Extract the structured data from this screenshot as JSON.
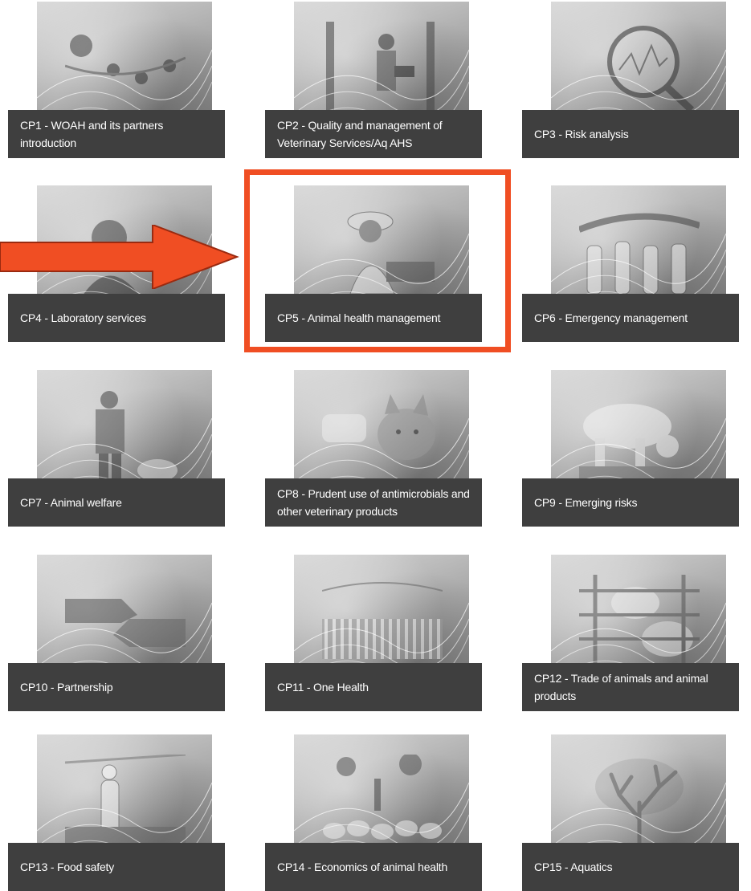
{
  "colors": {
    "caption_bg": "#3f3f3f",
    "caption_text": "#ffffff",
    "highlight": "#f04e23",
    "arrow": "#f04e23"
  },
  "annotation": {
    "highlighted_card": "CP5",
    "arrow_icon": "right-arrow-icon"
  },
  "cards": [
    {
      "id": "cp1",
      "title": "CP1 - WOAH and its partners introduction",
      "icon": "bees-photo-icon"
    },
    {
      "id": "cp2",
      "title": "CP2 - Quality and management of Veterinary Services/Aq AHS",
      "icon": "inspector-photo-icon"
    },
    {
      "id": "cp3",
      "title": "CP3 - Risk analysis",
      "icon": "magnifier-photo-icon"
    },
    {
      "id": "cp4",
      "title": "CP4 - Laboratory services",
      "icon": "scientist-photo-icon"
    },
    {
      "id": "cp5",
      "title": "CP5 - Animal health management",
      "icon": "beekeeper-photo-icon"
    },
    {
      "id": "cp6",
      "title": "CP6 - Emergency management",
      "icon": "hazmat-team-photo-icon"
    },
    {
      "id": "cp7",
      "title": "CP7 - Animal welfare",
      "icon": "farmer-photo-icon"
    },
    {
      "id": "cp8",
      "title": "CP8 - Prudent use of antimicrobials and other veterinary products",
      "icon": "cat-vet-photo-icon"
    },
    {
      "id": "cp9",
      "title": "CP9 - Emerging risks",
      "icon": "polar-bear-photo-icon"
    },
    {
      "id": "cp10",
      "title": "CP10 - Partnership",
      "icon": "handshake-photo-icon"
    },
    {
      "id": "cp11",
      "title": "CP11 - One Health",
      "icon": "underwater-photo-icon"
    },
    {
      "id": "cp12",
      "title": "CP12 - Trade of animals and animal products",
      "icon": "cattle-pen-photo-icon"
    },
    {
      "id": "cp13",
      "title": "CP13 - Food safety",
      "icon": "poultry-house-photo-icon"
    },
    {
      "id": "cp14",
      "title": "CP14 - Economics of animal health",
      "icon": "sheep-herd-photo-icon"
    },
    {
      "id": "cp15",
      "title": "CP15 - Aquatics",
      "icon": "coral-photo-icon"
    }
  ]
}
